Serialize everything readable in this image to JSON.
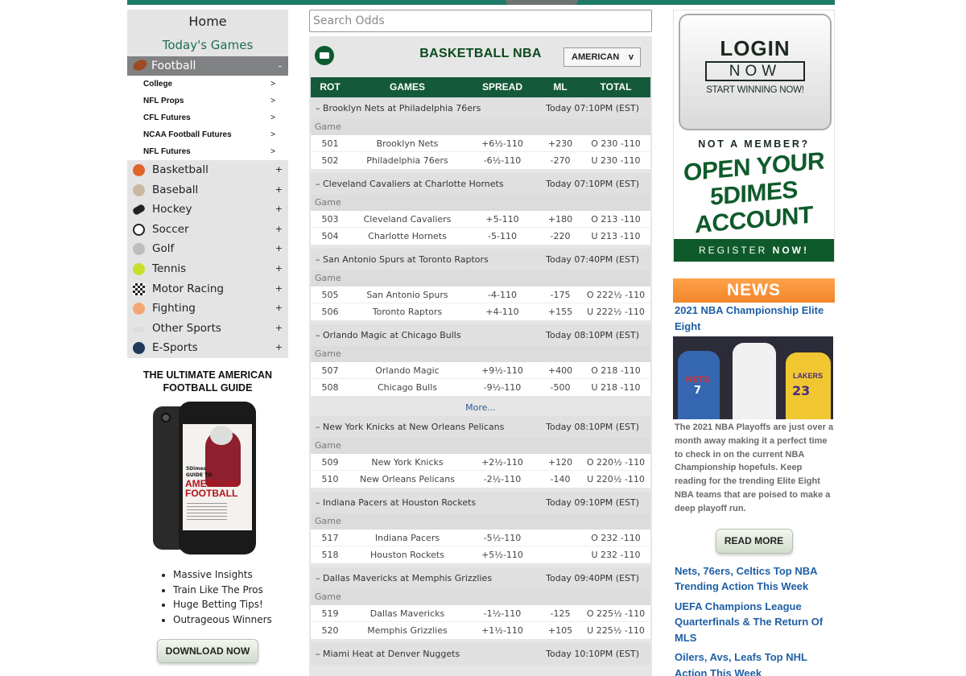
{
  "nav": {
    "home": "Home",
    "todays_games": "Today's Games",
    "football": {
      "label": "Football",
      "sign": "-"
    },
    "football_sub": [
      {
        "label": "College",
        "arrow": ">"
      },
      {
        "label": "NFL Props",
        "arrow": ">"
      },
      {
        "label": "CFL Futures",
        "arrow": ">"
      },
      {
        "label": "NCAA Football Futures",
        "arrow": ">"
      },
      {
        "label": "NFL Futures",
        "arrow": ">"
      }
    ],
    "sports": [
      {
        "label": "Basketball",
        "icon": "basketball-icon",
        "sign": "+"
      },
      {
        "label": "Baseball",
        "icon": "baseball-icon",
        "sign": "+"
      },
      {
        "label": "Hockey",
        "icon": "hockey-puck-icon",
        "sign": "+"
      },
      {
        "label": "Soccer",
        "icon": "soccer-ball-icon",
        "sign": "+"
      },
      {
        "label": "Golf",
        "icon": "golf-ball-icon",
        "sign": "+"
      },
      {
        "label": "Tennis",
        "icon": "tennis-ball-icon",
        "sign": "+"
      },
      {
        "label": "Motor Racing",
        "icon": "checkered-flag-icon",
        "sign": "+"
      },
      {
        "label": "Fighting",
        "icon": "boxing-glove-icon",
        "sign": "+"
      },
      {
        "label": "Other Sports",
        "icon": "other-sports-icon",
        "sign": "+"
      },
      {
        "label": "E-Sports",
        "icon": "gamepad-icon",
        "sign": "+"
      }
    ]
  },
  "guide": {
    "title_line1": "THE ULTIMATE AMERICAN",
    "title_line2": "FOOTBALL GUIDE",
    "phone_brand": "5Dimes",
    "phone_guide_to": "GUIDE TO",
    "phone_title": "AMERICAN FOOTBALL",
    "bullets": [
      "Massive Insights",
      "Train Like The Pros",
      "Huge Betting Tips!",
      "Outrageous Winners"
    ],
    "download_label": "DOWNLOAD NOW"
  },
  "search": {
    "placeholder": "Search Odds"
  },
  "odds": {
    "title": "BASKETBALL NBA",
    "format": "AMERICAN",
    "format_chevron": "v",
    "headers": {
      "rot": "ROT",
      "games": "GAMES",
      "spread": "SPREAD",
      "ml": "ML",
      "total": "TOTAL"
    },
    "game_label": "Game",
    "more": "More...",
    "matchups": [
      {
        "title": "Brooklyn Nets at Philadelphia 76ers",
        "time": "Today 07:10PM (EST)",
        "rows": [
          {
            "rot": "501",
            "team": "Brooklyn Nets",
            "spread": "+6½-110",
            "ml": "+230",
            "total": "O 230 -110"
          },
          {
            "rot": "502",
            "team": "Philadelphia 76ers",
            "spread": "-6½-110",
            "ml": "-270",
            "total": "U 230 -110"
          }
        ]
      },
      {
        "title": "Cleveland Cavaliers at Charlotte Hornets",
        "time": "Today 07:10PM (EST)",
        "rows": [
          {
            "rot": "503",
            "team": "Cleveland Cavaliers",
            "spread": "+5-110",
            "ml": "+180",
            "total": "O 213 -110"
          },
          {
            "rot": "504",
            "team": "Charlotte Hornets",
            "spread": "-5-110",
            "ml": "-220",
            "total": "U 213 -110"
          }
        ]
      },
      {
        "title": "San Antonio Spurs at Toronto Raptors",
        "time": "Today 07:40PM (EST)",
        "rows": [
          {
            "rot": "505",
            "team": "San Antonio Spurs",
            "spread": "-4-110",
            "ml": "-175",
            "total": "O 222½ -110"
          },
          {
            "rot": "506",
            "team": "Toronto Raptors",
            "spread": "+4-110",
            "ml": "+155",
            "total": "U 222½ -110"
          }
        ]
      },
      {
        "title": "Orlando Magic at Chicago Bulls",
        "time": "Today 08:10PM (EST)",
        "rows": [
          {
            "rot": "507",
            "team": "Orlando Magic",
            "spread": "+9½-110",
            "ml": "+400",
            "total": "O 218 -110"
          },
          {
            "rot": "508",
            "team": "Chicago Bulls",
            "spread": "-9½-110",
            "ml": "-500",
            "total": "U 218 -110"
          }
        ]
      },
      {
        "title": "New York Knicks at New Orleans Pelicans",
        "time": "Today 08:10PM (EST)",
        "rows": [
          {
            "rot": "509",
            "team": "New York Knicks",
            "spread": "+2½-110",
            "ml": "+120",
            "total": "O 220½ -110"
          },
          {
            "rot": "510",
            "team": "New Orleans Pelicans",
            "spread": "-2½-110",
            "ml": "-140",
            "total": "U 220½ -110"
          }
        ]
      },
      {
        "title": "Indiana Pacers at Houston Rockets",
        "time": "Today 09:10PM (EST)",
        "rows": [
          {
            "rot": "517",
            "team": "Indiana Pacers",
            "spread": "-5½-110",
            "ml": "",
            "total": "O 232 -110"
          },
          {
            "rot": "518",
            "team": "Houston Rockets",
            "spread": "+5½-110",
            "ml": "",
            "total": "U 232 -110"
          }
        ]
      },
      {
        "title": "Dallas Mavericks at Memphis Grizzlies",
        "time": "Today 09:40PM (EST)",
        "rows": [
          {
            "rot": "519",
            "team": "Dallas Mavericks",
            "spread": "-1½-110",
            "ml": "-125",
            "total": "O 225½ -110"
          },
          {
            "rot": "520",
            "team": "Memphis Grizzlies",
            "spread": "+1½-110",
            "ml": "+105",
            "total": "U 225½ -110"
          }
        ]
      },
      {
        "title": "Miami Heat at Denver Nuggets",
        "time": "Today 10:10PM (EST)",
        "rows": []
      }
    ]
  },
  "promo": {
    "login": "LOGIN",
    "now": "NOW",
    "start": "START WINNING NOW!",
    "not_member": "NOT A MEMBER?",
    "open1": "OPEN YOUR",
    "open2": "5DIMES",
    "open3": "ACCOUNT",
    "register": "REGISTER",
    "register_now": "NOW!"
  },
  "news": {
    "header": "NEWS",
    "feature_title": "2021 NBA Championship Elite Eight",
    "image_text_nets": "NETS",
    "image_number_nets": "7",
    "image_text_lakers": "LAKERS",
    "image_number_lakers": "23",
    "feature_body": "The 2021 NBA Playoffs are just over a month away making it a perfect time to check in on the current NBA Championship hopefuls. Keep reading for the trending Elite Eight NBA teams that are poised to make a deep playoff run.",
    "read_more": "READ MORE",
    "links": [
      "Nets, 76ers, Celtics Top NBA Trending Action This Week",
      "UEFA Champions League Quarterfinals & The Return Of MLS",
      "Oilers, Avs, Leafs Top NHL Action This Week"
    ]
  }
}
